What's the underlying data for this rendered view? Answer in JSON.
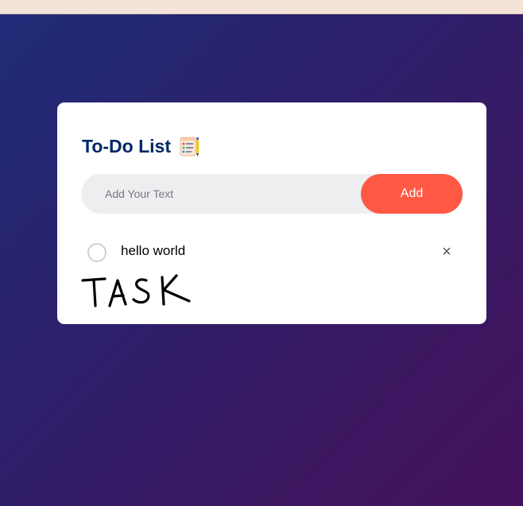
{
  "app": {
    "title": "To-Do List",
    "title_icon": "notepad-icon"
  },
  "input": {
    "placeholder": "Add Your Text",
    "value": ""
  },
  "buttons": {
    "add_label": "Add"
  },
  "tasks": [
    {
      "text": "hello world",
      "checked": false,
      "remove_label": "×"
    }
  ],
  "annotation": {
    "handwritten_text": "TASK"
  },
  "colors": {
    "title": "#002765",
    "add_button": "#ff5945",
    "input_background": "#edeef0",
    "background_start": "#1f2d78",
    "background_end": "#45115c"
  }
}
